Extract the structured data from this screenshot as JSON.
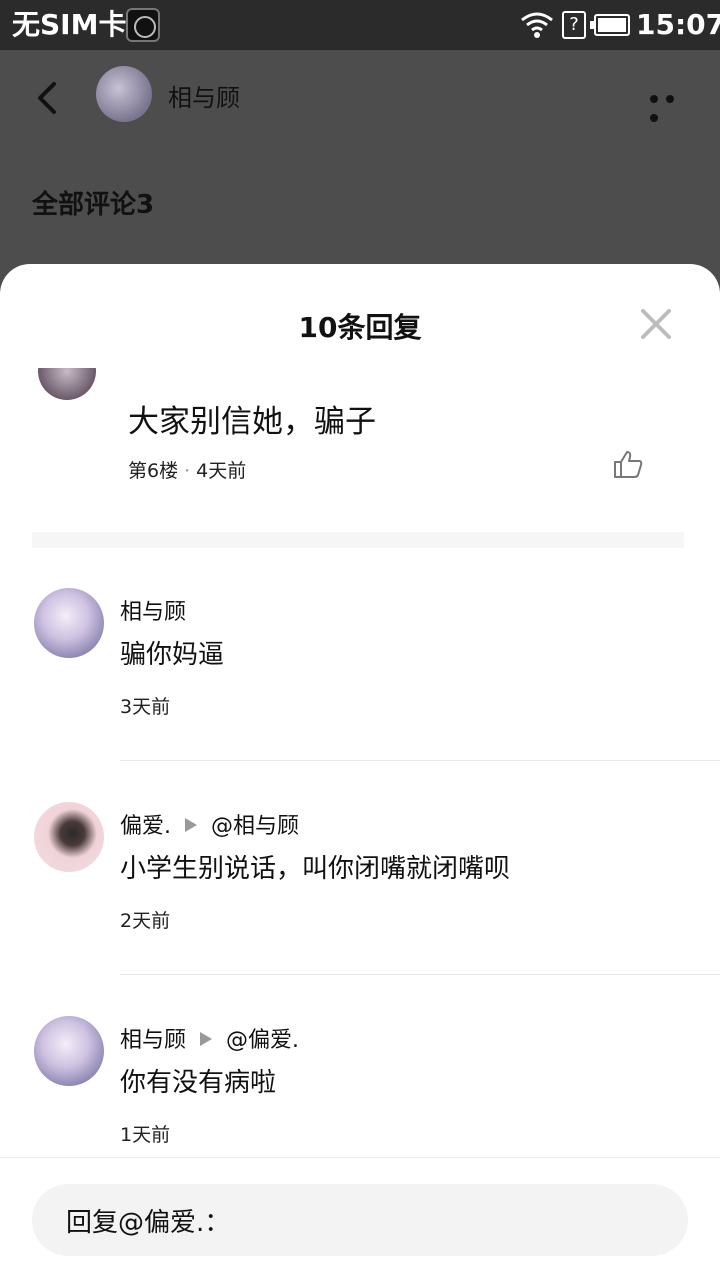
{
  "status_bar": {
    "carrier": "无SIM卡",
    "time": "15:07",
    "sim_icon_label": "?"
  },
  "header": {
    "user_name": "相与顾",
    "section_title": "全部评论3"
  },
  "sheet": {
    "title": "10条回复",
    "main_comment": {
      "text": "大家别信她，骗子",
      "floor": "第6楼",
      "separator": "·",
      "time": "4天前"
    },
    "replies": [
      {
        "author": "相与顾",
        "reply_to": "",
        "text": "骗你妈逼",
        "time": "3天前",
        "avatar_style": "a"
      },
      {
        "author": "偏爱.",
        "reply_to": "@相与顾",
        "text": "小学生别说话，叫你闭嘴就闭嘴呗",
        "time": "2天前",
        "avatar_style": "b"
      },
      {
        "author": "相与顾",
        "reply_to": "@偏爱.",
        "text": "你有没有病啦",
        "time": "1天前",
        "avatar_style": "a"
      }
    ]
  },
  "input": {
    "placeholder": "回复@偏爱.："
  },
  "icons": {
    "back": "back-arrow-icon",
    "more": "more-dots-icon",
    "close": "close-icon",
    "like": "thumbs-up-icon"
  }
}
